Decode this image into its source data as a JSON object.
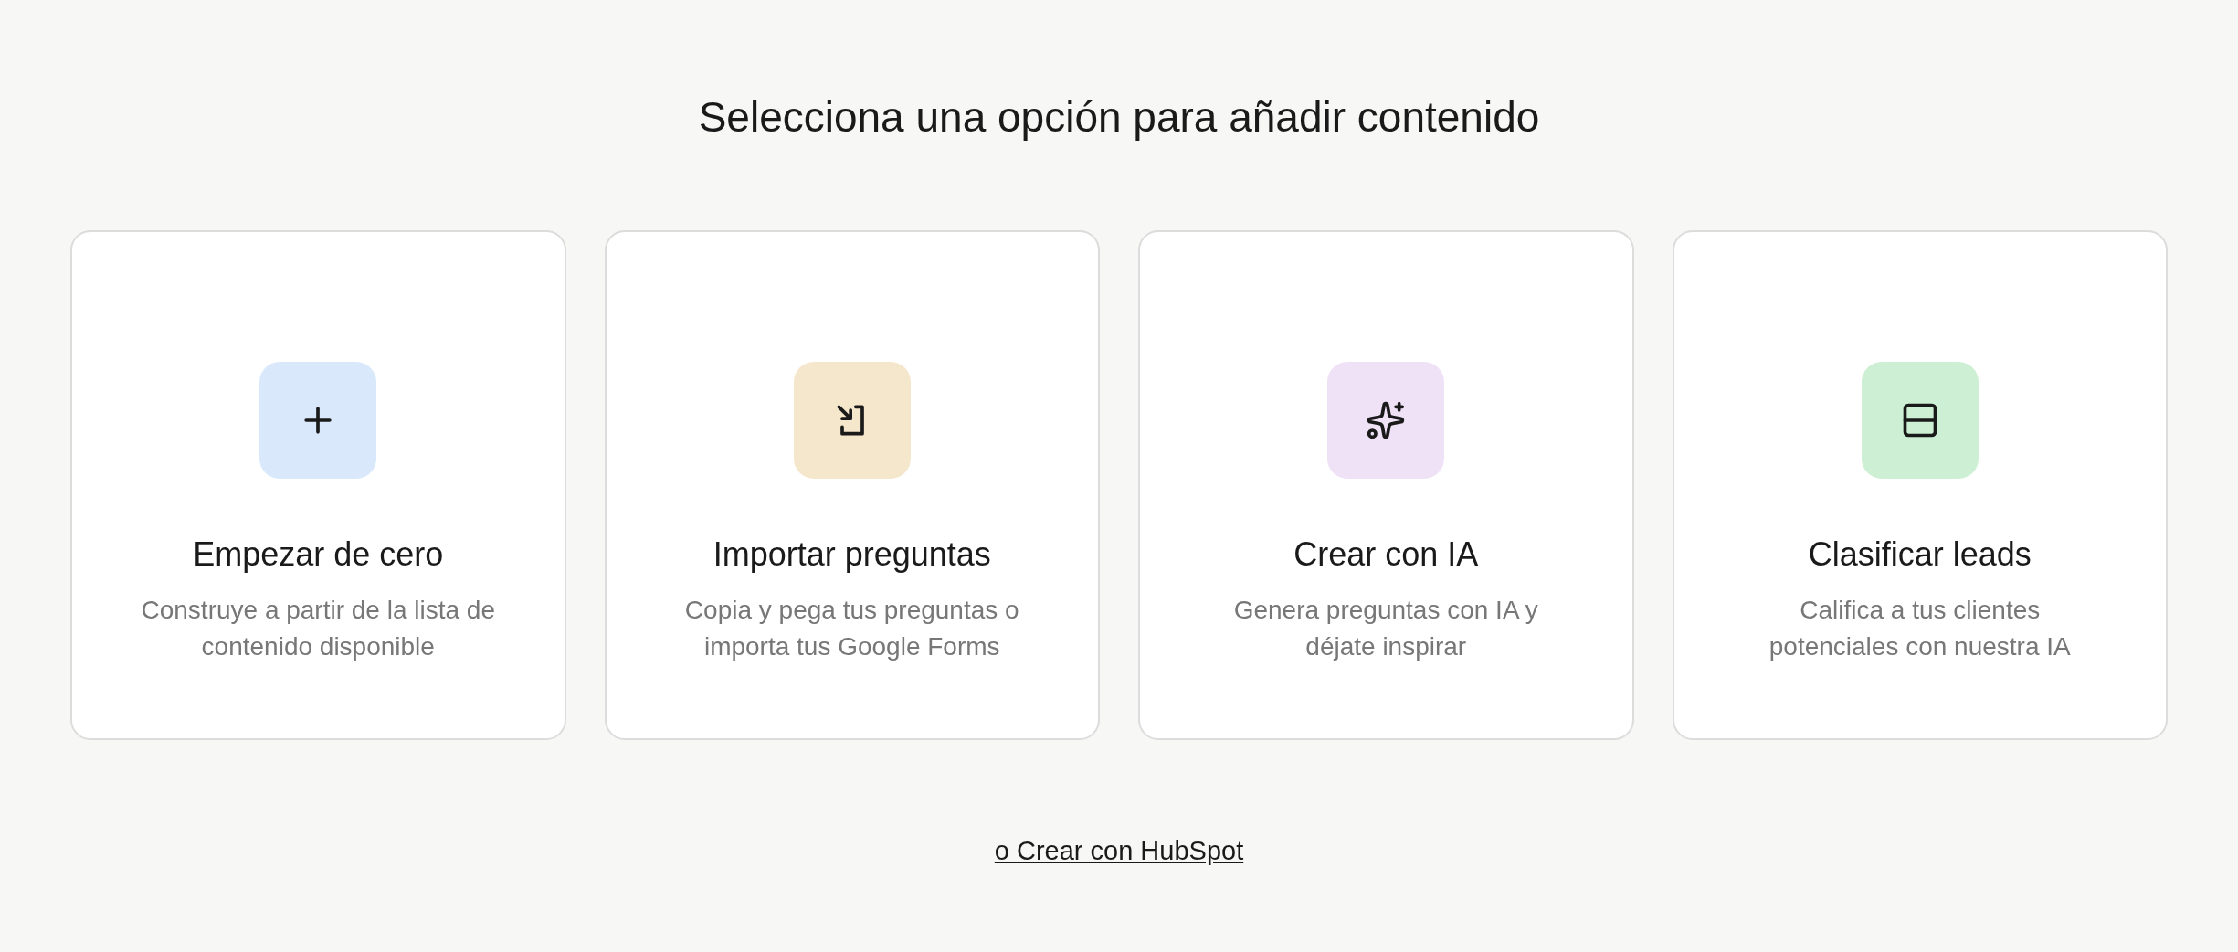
{
  "heading": "Selecciona una opción para añadir contenido",
  "options": [
    {
      "kind": "plus",
      "color": "#d9e9fb",
      "title": "Empezar de cero",
      "description": "Construye a partir de la lista de contenido disponible"
    },
    {
      "kind": "import",
      "color": "#f5e7cb",
      "title": "Importar preguntas",
      "description": "Copia y pega tus preguntas o importa tus Google Forms"
    },
    {
      "kind": "sparkles",
      "color": "#efe2f7",
      "title": "Crear con IA",
      "description": "Genera preguntas con IA y déjate inspirar"
    },
    {
      "kind": "rows",
      "color": "#cdf0d5",
      "title": "Clasificar leads",
      "description": "Califica a tus clientes potenciales con nuestra IA"
    }
  ],
  "link": "o Crear con HubSpot"
}
